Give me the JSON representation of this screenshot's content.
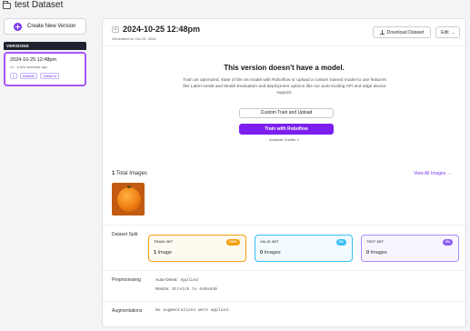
{
  "header": {
    "dataset_title": "test Dataset"
  },
  "sidebar": {
    "create_button": "Create New Version",
    "versions_heading": "VERSIONS",
    "version": {
      "title": "2024-10-25 12:48pm",
      "subtitle": "v1 · a few seconds ago",
      "chips": [
        "1",
        "640x640",
        "Stretch to"
      ]
    }
  },
  "main": {
    "version_badge": "v1",
    "title": "2024-10-25 12:48pm",
    "generated": "Generated on Oct 25, 2024",
    "download_label": "Download Dataset",
    "edit_label": "Edit",
    "no_model_title": "This version doesn't have a model.",
    "no_model_desc": "Train an optimized, state of the art model with Roboflow or upload a custom trained model to use features like Label Assist and Model Evaluation and deployment options like our auto-scaling API and edge device support.",
    "custom_button": "Custom Train and Upload",
    "train_button": "Train with Roboflow",
    "credits_text": "Available Credits: 2",
    "total_count": "1",
    "total_label": "Total Images",
    "view_all": "View All Images →",
    "split_label": "Dataset Split",
    "splits": [
      {
        "name": "TRAIN SET",
        "pill": "100%",
        "count": "1",
        "unit": "Image"
      },
      {
        "name": "VALID SET",
        "pill": "0%",
        "count": "0",
        "unit": "Images"
      },
      {
        "name": "TEST SET",
        "pill": "0%",
        "count": "0",
        "unit": "Images"
      }
    ],
    "preprocessing_label": "Preprocessing",
    "preprocessing": [
      {
        "key": "Auto-Orient:",
        "value": "Applied"
      },
      {
        "key": "Resize:",
        "value": "Stretch to 640x640"
      }
    ],
    "augmentations_label": "Augmentations",
    "augmentations_text": "No augmentations were applied."
  }
}
